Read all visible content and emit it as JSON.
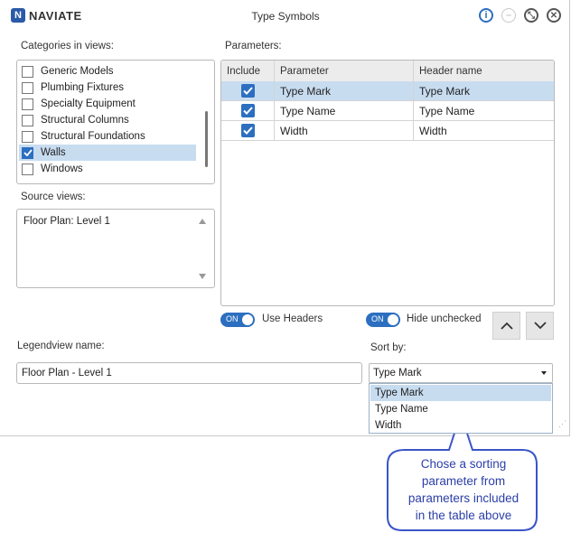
{
  "window": {
    "brand": "NAVIATE",
    "brand_mark": "N",
    "title": "Type Symbols",
    "buttons": {
      "info": "i",
      "minimize": "–",
      "restore": "⤡",
      "close": "✕"
    }
  },
  "categories": {
    "label": "Categories in views:",
    "items": [
      {
        "label": "Generic Models",
        "checked": false
      },
      {
        "label": "Plumbing Fixtures",
        "checked": false
      },
      {
        "label": "Specialty Equipment",
        "checked": false
      },
      {
        "label": "Structural Columns",
        "checked": false
      },
      {
        "label": "Structural Foundations",
        "checked": false
      },
      {
        "label": "Walls",
        "checked": true
      },
      {
        "label": "Windows",
        "checked": false
      }
    ]
  },
  "source_views": {
    "label": "Source views:",
    "items": [
      "Floor Plan: Level 1"
    ]
  },
  "parameters": {
    "label": "Parameters:",
    "columns": [
      "Include",
      "Parameter",
      "Header name"
    ],
    "rows": [
      {
        "include": true,
        "parameter": "Type Mark",
        "header": "Type Mark"
      },
      {
        "include": true,
        "parameter": "Type Name",
        "header": "Type Name"
      },
      {
        "include": true,
        "parameter": "Width",
        "header": "Width"
      }
    ]
  },
  "toggles": {
    "use_headers": {
      "state": "ON",
      "label": "Use Headers"
    },
    "hide_unchecked": {
      "state": "ON",
      "label": "Hide unchecked"
    }
  },
  "legendview": {
    "label": "Legendview name:",
    "value": "Floor Plan - Level 1"
  },
  "sort_by": {
    "label": "Sort by:",
    "value": "Type Mark",
    "options": [
      "Type Mark",
      "Type Name",
      "Width"
    ]
  },
  "callout": {
    "lines": [
      "Chose a sorting",
      "parameter from",
      "parameters included",
      "in the table above"
    ]
  },
  "colors": {
    "accent": "#2c6fc0",
    "selection": "#c8dcf0",
    "callout": "#3a55c8"
  }
}
